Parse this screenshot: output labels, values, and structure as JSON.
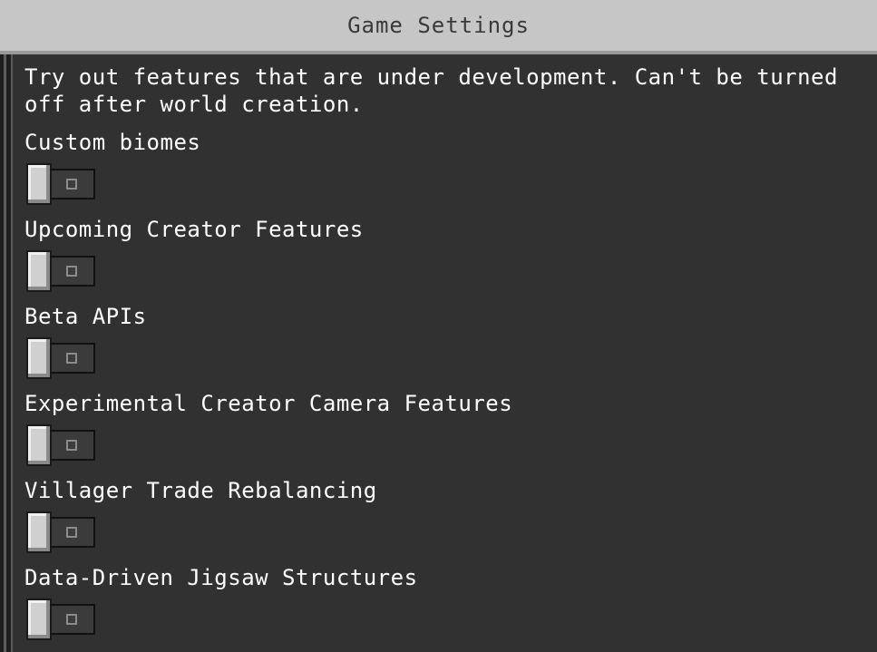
{
  "header": {
    "title": "Game Settings"
  },
  "main": {
    "description": "Try out features that are under development. Can't be turned off after world creation.",
    "settings": [
      {
        "label": "Custom biomes",
        "state": "off",
        "state_glyph": "O"
      },
      {
        "label": "Upcoming Creator Features",
        "state": "off",
        "state_glyph": "O"
      },
      {
        "label": "Beta APIs",
        "state": "off",
        "state_glyph": "O"
      },
      {
        "label": "Experimental Creator Camera Features",
        "state": "off",
        "state_glyph": "O"
      },
      {
        "label": "Villager Trade Rebalancing",
        "state": "off",
        "state_glyph": "O"
      },
      {
        "label": "Data-Driven Jigsaw Structures",
        "state": "off",
        "state_glyph": "O"
      }
    ]
  },
  "colors": {
    "background": "#313131",
    "header_background": "#c6c6c6",
    "header_text": "#3a3a3a",
    "text": "#ffffff",
    "toggle_knob": "#d0d0d0",
    "toggle_track": "#3b3b3b"
  }
}
